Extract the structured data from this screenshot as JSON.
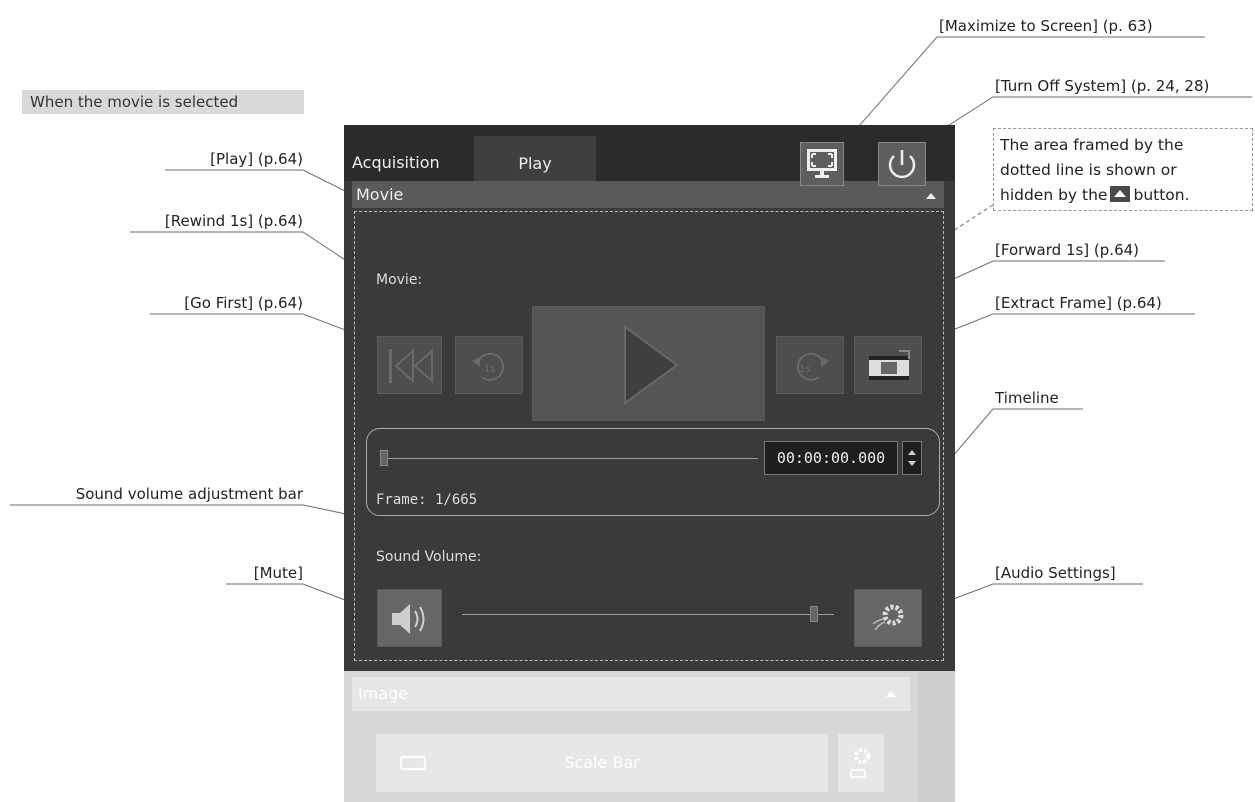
{
  "annotations": {
    "maximize": "[Maximize to Screen] (p. 63)",
    "turn_off": "[Turn Off System] (p. 24, 28)",
    "play": "[Play] (p.64)",
    "rewind": "[Rewind 1s] (p.64)",
    "go_first": "[Go First] (p.64)",
    "forward": "[Forward 1s] (p.64)",
    "extract": "[Extract Frame] (p.64)",
    "timeline": "Timeline",
    "volume_bar": "Sound volume adjustment bar",
    "mute": "[Mute]",
    "audio_settings": "[Audio Settings]"
  },
  "selection_label": "When the movie is selected",
  "note": {
    "line1": "The area framed by the",
    "line2": "dotted line is shown or",
    "line3_a": "hidden by the",
    "line3_b": "button."
  },
  "tabs": [
    {
      "label": "Acquisition"
    },
    {
      "label": "Play"
    }
  ],
  "movie": {
    "section_title": "Movie",
    "label": "Movie:",
    "time_value": "00:00:00.000",
    "frame_text": "Frame: 1/665",
    "timeline_position": 0.0,
    "volume_label": "Sound Volume:",
    "volume_level": 1.0
  },
  "image": {
    "section_title": "Image",
    "scale_bar_label": "Scale Bar"
  },
  "colors": {
    "panel_bg": "#3a3a3a",
    "topbar_bg": "#2b2b2b",
    "header_bg": "#5a5a5a"
  }
}
